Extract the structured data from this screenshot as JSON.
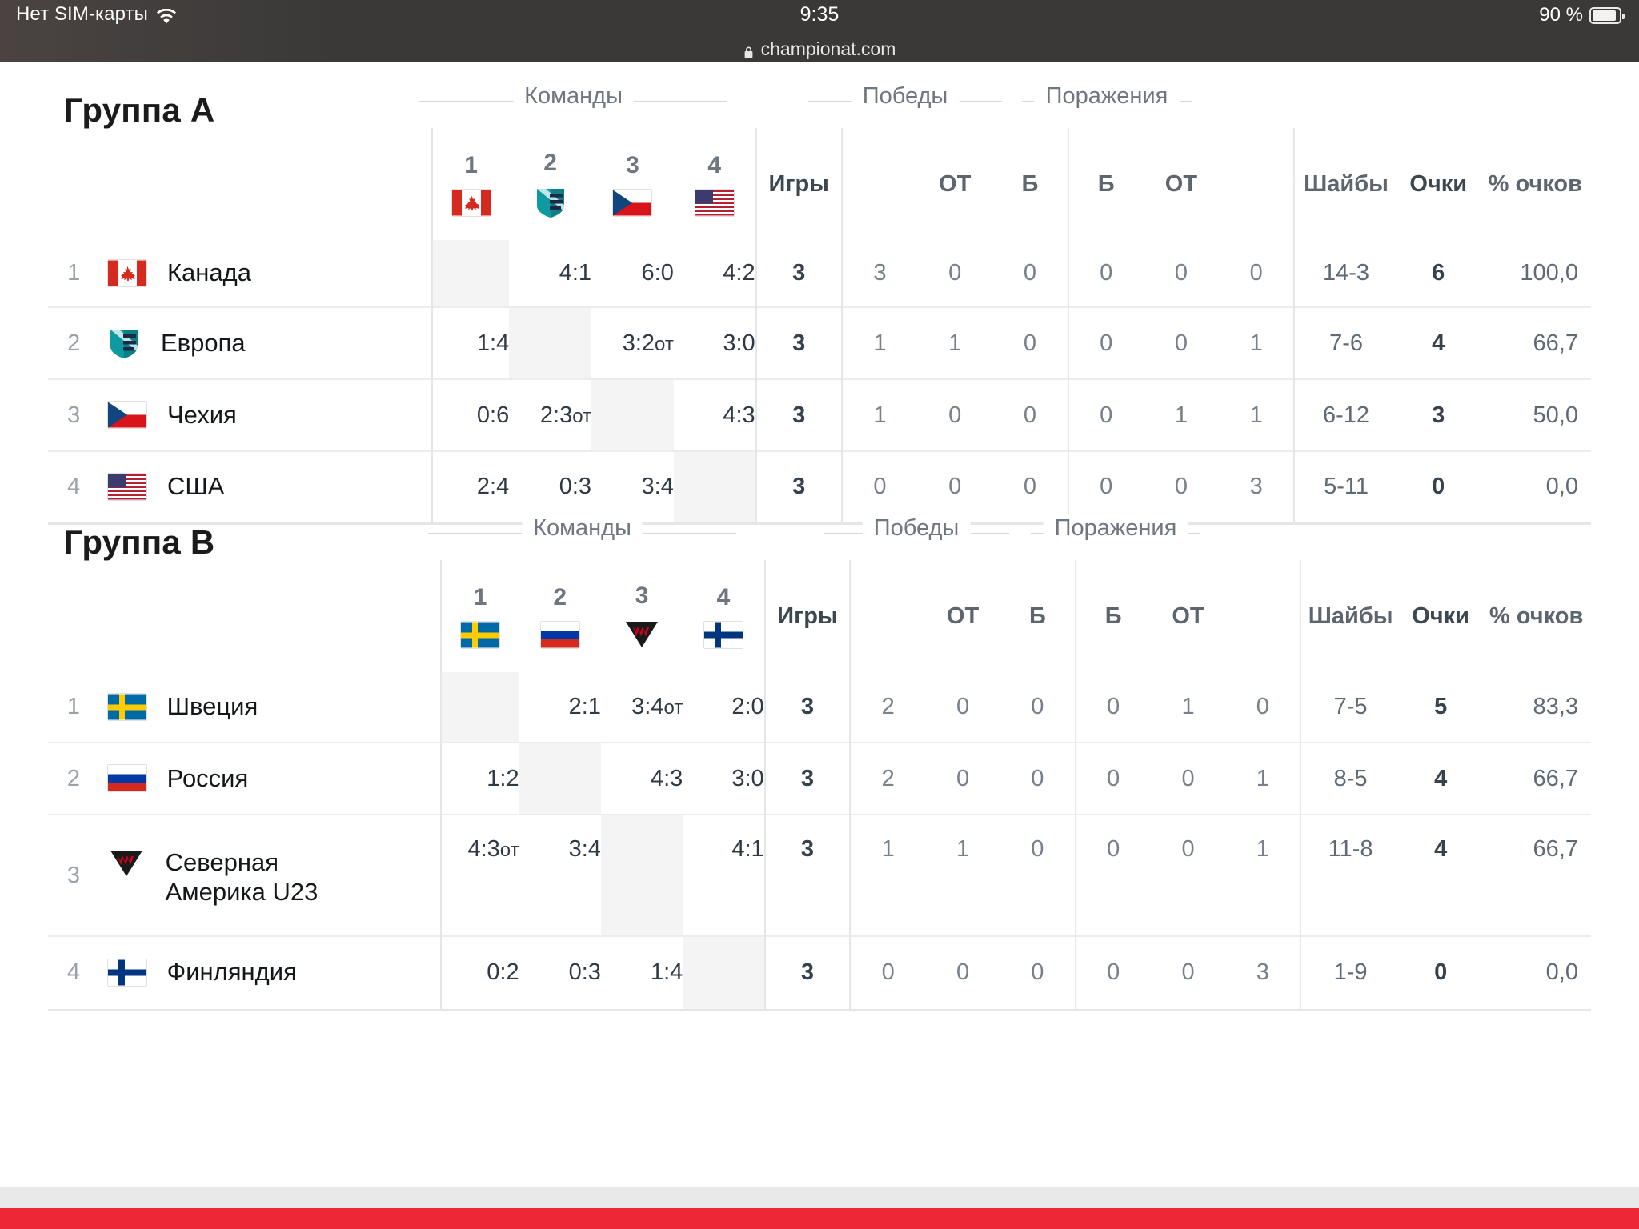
{
  "status_bar": {
    "carrier": "Нет SIM-карты",
    "wifi_icon": "wifi-icon",
    "time": "9:35",
    "battery_percent": "90 %",
    "battery_icon": "battery-icon"
  },
  "url_bar": {
    "lock_icon": "lock-icon",
    "url": "championat.com"
  },
  "columns": {
    "group_caption_teams": "Команды",
    "group_caption_wins": "Победы",
    "group_caption_losses": "Поражения",
    "games": "Игры",
    "win_ot": "ОТ",
    "win_so": "Б",
    "loss_so": "Б",
    "loss_ot": "ОТ",
    "goals": "Шайбы",
    "points": "Очки",
    "points_pct": "% очков",
    "team_nums": [
      "1",
      "2",
      "3",
      "4"
    ]
  },
  "colors": {
    "qualified_marker": "#8bba45",
    "accent_red": "#ee2737",
    "header_text": "#6e7780",
    "value_text": "#5e6a74"
  },
  "groups": [
    {
      "title": "Группа A",
      "rows": [
        {
          "rank": "1",
          "qualified": true,
          "flag": "flag-canada",
          "team": "Канада",
          "matches": [
            "",
            "4:1",
            "6:0",
            "4:2"
          ],
          "games": "3",
          "win": "3",
          "win_ot": "0",
          "win_so": "0",
          "loss_so": "0",
          "loss_ot": "0",
          "loss": "0",
          "goals": "14-3",
          "points": "6",
          "points_pct": "100,0"
        },
        {
          "rank": "2",
          "qualified": true,
          "flag": "flag-europe",
          "team": "Европа",
          "matches": [
            "1:4",
            "",
            "3:2от",
            "3:0"
          ],
          "games": "3",
          "win": "1",
          "win_ot": "1",
          "win_so": "0",
          "loss_so": "0",
          "loss_ot": "0",
          "loss": "1",
          "goals": "7-6",
          "points": "4",
          "points_pct": "66,7"
        },
        {
          "rank": "3",
          "qualified": false,
          "flag": "flag-czech",
          "team": "Чехия",
          "matches": [
            "0:6",
            "2:3от",
            "",
            "4:3"
          ],
          "games": "3",
          "win": "1",
          "win_ot": "0",
          "win_so": "0",
          "loss_so": "0",
          "loss_ot": "1",
          "loss": "1",
          "goals": "6-12",
          "points": "3",
          "points_pct": "50,0"
        },
        {
          "rank": "4",
          "qualified": false,
          "flag": "flag-usa",
          "team": "США",
          "matches": [
            "2:4",
            "0:3",
            "3:4",
            ""
          ],
          "games": "3",
          "win": "0",
          "win_ot": "0",
          "win_so": "0",
          "loss_so": "0",
          "loss_ot": "0",
          "loss": "3",
          "goals": "5-11",
          "points": "0",
          "points_pct": "0,0"
        }
      ]
    },
    {
      "title": "Группа B",
      "rows": [
        {
          "rank": "1",
          "qualified": true,
          "flag": "flag-sweden",
          "team": "Швеция",
          "matches": [
            "",
            "2:1",
            "3:4от",
            "2:0"
          ],
          "games": "3",
          "win": "2",
          "win_ot": "0",
          "win_so": "0",
          "loss_so": "0",
          "loss_ot": "1",
          "loss": "0",
          "goals": "7-5",
          "points": "5",
          "points_pct": "83,3"
        },
        {
          "rank": "2",
          "qualified": true,
          "flag": "flag-russia",
          "team": "Россия",
          "matches": [
            "1:2",
            "",
            "4:3",
            "3:0"
          ],
          "games": "3",
          "win": "2",
          "win_ot": "0",
          "win_so": "0",
          "loss_so": "0",
          "loss_ot": "0",
          "loss": "1",
          "goals": "8-5",
          "points": "4",
          "points_pct": "66,7"
        },
        {
          "rank": "3",
          "qualified": false,
          "flag": "flag-north-america-u23",
          "team": "Северная Америка U23",
          "matches": [
            "4:3от",
            "3:4",
            "",
            "4:1"
          ],
          "games": "3",
          "win": "1",
          "win_ot": "1",
          "win_so": "0",
          "loss_so": "0",
          "loss_ot": "0",
          "loss": "1",
          "goals": "11-8",
          "points": "4",
          "points_pct": "66,7"
        },
        {
          "rank": "4",
          "qualified": false,
          "flag": "flag-finland",
          "team": "Финляндия",
          "matches": [
            "0:2",
            "0:3",
            "1:4",
            ""
          ],
          "games": "3",
          "win": "0",
          "win_ot": "0",
          "win_so": "0",
          "loss_so": "0",
          "loss_ot": "0",
          "loss": "3",
          "goals": "1-9",
          "points": "0",
          "points_pct": "0,0"
        }
      ]
    }
  ]
}
